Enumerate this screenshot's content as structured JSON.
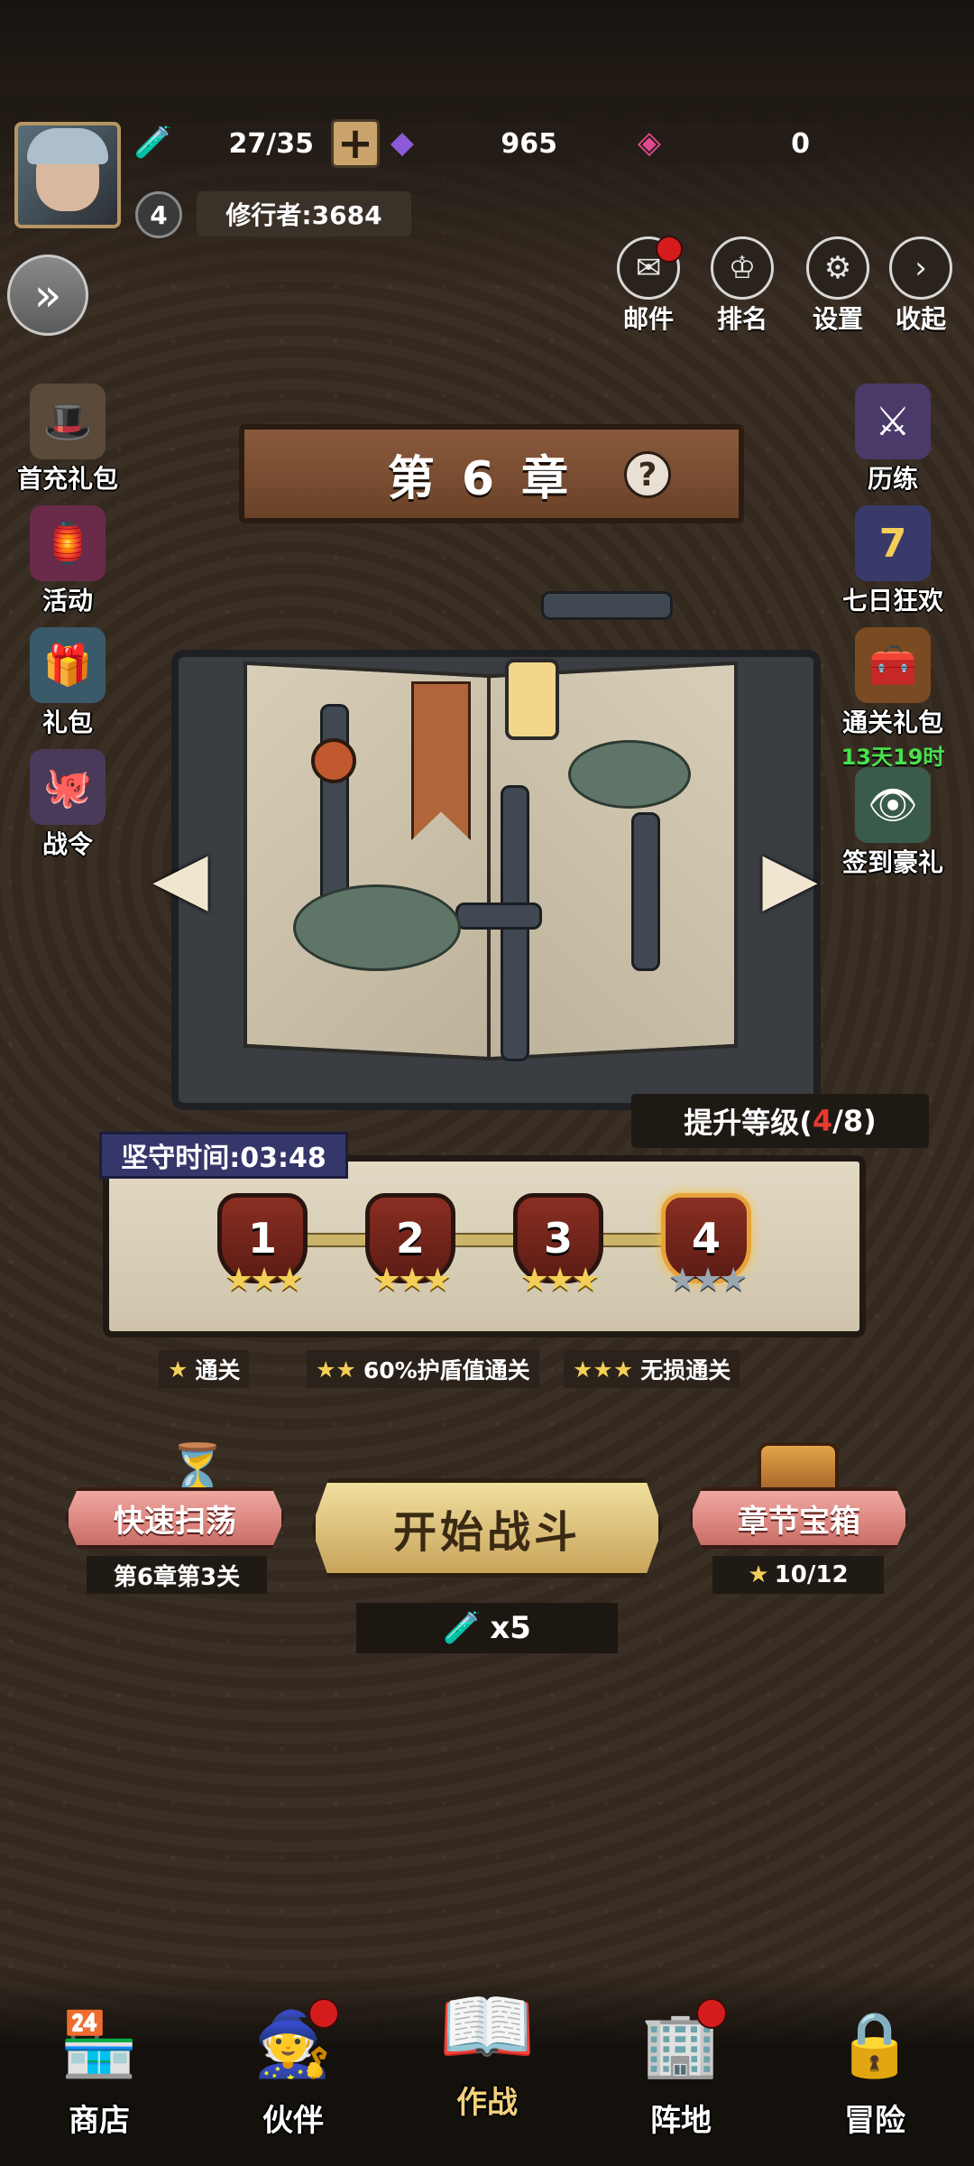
{
  "header": {
    "stamina": "27/35",
    "gems": "965",
    "tickets": "0",
    "level": "4",
    "player_name": "修行者:3684"
  },
  "top_menu": [
    {
      "label": "邮件",
      "icon": "mail-icon",
      "badge": true
    },
    {
      "label": "排名",
      "icon": "medal-icon",
      "badge": false
    },
    {
      "label": "设置",
      "icon": "gear-icon",
      "badge": false
    },
    {
      "label": "收起",
      "icon": "chevron-right-icon",
      "badge": false
    }
  ],
  "left_menu": [
    {
      "label": "首充礼包",
      "icon": "first-recharge-icon"
    },
    {
      "label": "活动",
      "icon": "event-icon"
    },
    {
      "label": "礼包",
      "icon": "gift-icon"
    },
    {
      "label": "战令",
      "icon": "battle-pass-icon"
    }
  ],
  "right_menu": [
    {
      "label": "历练",
      "icon": "trial-icon",
      "sub": ""
    },
    {
      "label": "七日狂欢",
      "icon": "seven-day-icon",
      "sub": ""
    },
    {
      "label": "通关礼包",
      "icon": "clear-gift-icon",
      "sub": "13天19时"
    },
    {
      "label": "签到豪礼",
      "icon": "checkin-icon",
      "sub": ""
    }
  ],
  "chapter": {
    "title": "第6章",
    "upgrade_label": "提升等级(",
    "upgrade_current": "4",
    "upgrade_total": "/8)",
    "timer": "坚守时间:03:48"
  },
  "stages": [
    {
      "number": "1",
      "stars": 3
    },
    {
      "number": "2",
      "stars": 3
    },
    {
      "number": "3",
      "stars": 3
    },
    {
      "number": "4",
      "stars": 0
    }
  ],
  "legend": [
    {
      "stars": "★",
      "text": "通关"
    },
    {
      "stars": "★★",
      "text": "60%护盾值通关"
    },
    {
      "stars": "★★★",
      "text": "无损通关"
    }
  ],
  "actions": {
    "sweep_label": "快速扫荡",
    "sweep_sub": "第6章第3关",
    "start_label": "开始战斗",
    "cost": "x5",
    "chest_label": "章节宝箱",
    "chest_progress": "10/12"
  },
  "bottom_nav": [
    {
      "label": "商店",
      "icon": "shop-icon",
      "badge": false,
      "active": false
    },
    {
      "label": "伙伴",
      "icon": "wizard-hat-icon",
      "badge": true,
      "active": false
    },
    {
      "label": "作战",
      "icon": "battle-book-icon",
      "badge": false,
      "active": true
    },
    {
      "label": "阵地",
      "icon": "building-icon",
      "badge": true,
      "active": false
    },
    {
      "label": "冒险",
      "icon": "adventure-lock-icon",
      "badge": false,
      "active": false
    }
  ],
  "colors": {
    "accent_gold": "#f4cf57",
    "alert_red": "#d51c1c",
    "timer_green": "#48e04e"
  }
}
